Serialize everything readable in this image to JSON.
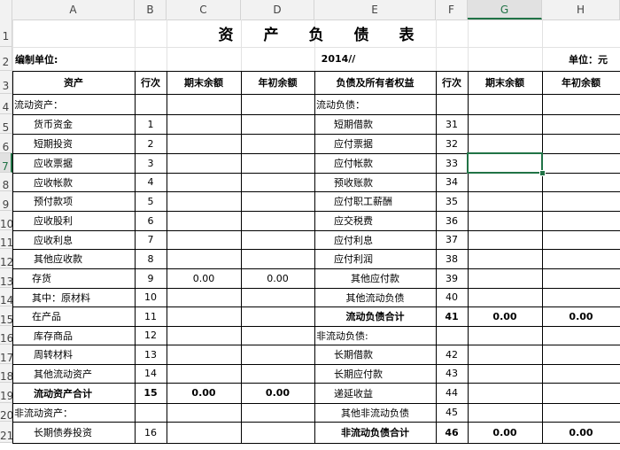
{
  "columns": [
    "A",
    "B",
    "C",
    "D",
    "E",
    "F",
    "G",
    "H"
  ],
  "selected_column": "G",
  "selected_row": "7",
  "title": "资　　产　　负　　债　　表",
  "company_label": "编制单位:",
  "year": "2014//",
  "unit": "单位：元",
  "headers": [
    "资产",
    "行次",
    "期末余额",
    "年初余额",
    "负债及所有者权益",
    "行次",
    "期末余额",
    "年初余额"
  ],
  "rows": [
    {
      "num": "4",
      "a": "流动资产：",
      "b": "",
      "c": "",
      "d": "",
      "e": "流动负债：",
      "f": "",
      "g": "",
      "h": ""
    },
    {
      "num": "5",
      "a": "货币资金",
      "b": "1",
      "c": "",
      "d": "",
      "e": "短期借款",
      "f": "31",
      "g": "",
      "h": ""
    },
    {
      "num": "6",
      "a": "短期投资",
      "b": "2",
      "c": "",
      "d": "",
      "e": "应付票据",
      "f": "32",
      "g": "",
      "h": ""
    },
    {
      "num": "7",
      "a": "应收票据",
      "b": "3",
      "c": "",
      "d": "",
      "e": "应付帐款",
      "f": "33",
      "g": "",
      "h": ""
    },
    {
      "num": "8",
      "a": "应收帐款",
      "b": "4",
      "c": "",
      "d": "",
      "e": "预收账款",
      "f": "34",
      "g": "",
      "h": ""
    },
    {
      "num": "9",
      "a": "预付款项",
      "b": "5",
      "c": "",
      "d": "",
      "e": "应付职工薪酬",
      "f": "35",
      "g": "",
      "h": ""
    },
    {
      "num": "10",
      "a": "应收股利",
      "b": "6",
      "c": "",
      "d": "",
      "e": "应交税费",
      "f": "36",
      "g": "",
      "h": ""
    },
    {
      "num": "11",
      "a": "应收利息",
      "b": "7",
      "c": "",
      "d": "",
      "e": "应付利息",
      "f": "37",
      "g": "",
      "h": ""
    },
    {
      "num": "12",
      "a": "其他应收款",
      "b": "8",
      "c": "",
      "d": "",
      "e": "应付利润",
      "f": "38",
      "g": "",
      "h": ""
    },
    {
      "num": "13",
      "a": "存货",
      "b": "9",
      "c": "0.00",
      "d": "0.00",
      "e": "其他应付款",
      "f": "39",
      "g": "",
      "h": ""
    },
    {
      "num": "14",
      "a": "其中：原材料",
      "b": "10",
      "c": "",
      "d": "",
      "e": "其他流动负债",
      "f": "40",
      "g": "",
      "h": ""
    },
    {
      "num": "15",
      "a": "在产品",
      "b": "11",
      "c": "",
      "d": "",
      "e": "流动负债合计",
      "f": "41",
      "g": "0.00",
      "h": "0.00"
    },
    {
      "num": "16",
      "a": "库存商品",
      "b": "12",
      "c": "",
      "d": "",
      "e": "非流动负债:",
      "f": "",
      "g": "",
      "h": ""
    },
    {
      "num": "17",
      "a": "周转材料",
      "b": "13",
      "c": "",
      "d": "",
      "e": "长期借款",
      "f": "42",
      "g": "",
      "h": ""
    },
    {
      "num": "18",
      "a": "其他流动资产",
      "b": "14",
      "c": "",
      "d": "",
      "e": "长期应付款",
      "f": "43",
      "g": "",
      "h": ""
    },
    {
      "num": "19",
      "a": "流动资产合计",
      "b": "15",
      "c": "0.00",
      "d": "0.00",
      "e": "递延收益",
      "f": "44",
      "g": "",
      "h": ""
    },
    {
      "num": "20",
      "a": "非流动资产：",
      "b": "",
      "c": "",
      "d": "",
      "e": "其他非流动负债",
      "f": "45",
      "g": "",
      "h": ""
    },
    {
      "num": "21",
      "a": "长期债券投资",
      "b": "16",
      "c": "",
      "d": "",
      "e": "非流动负债合计",
      "f": "46",
      "g": "0.00",
      "h": "0.00"
    }
  ],
  "row_numbers_top": [
    "1",
    "2",
    "3"
  ]
}
